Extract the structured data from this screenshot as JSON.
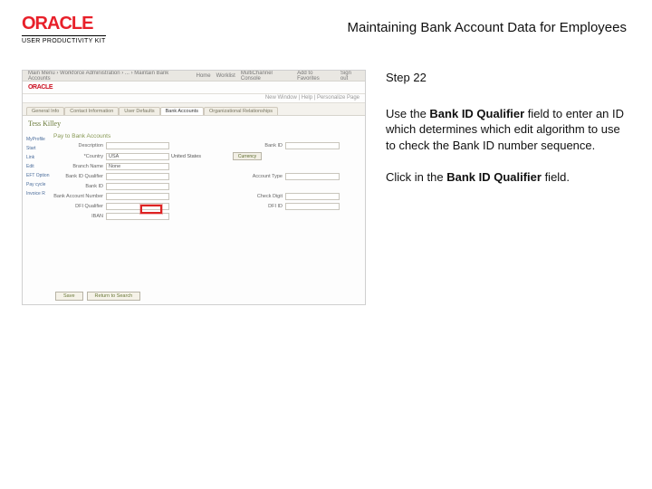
{
  "header": {
    "logo_text": "ORACLE",
    "logo_sub": "USER PRODUCTIVITY KIT",
    "title": "Maintaining Bank Account Data for Employees"
  },
  "instructions": {
    "step_label": "Step 22",
    "p1_pre": "Use the ",
    "p1_bold": "Bank ID Qualifier",
    "p1_post": " field to enter an ID which determines which edit algorithm to use to check the Bank ID number sequence.",
    "p2_pre": "Click in the ",
    "p2_bold": "Bank ID Qualifier",
    "p2_post": " field."
  },
  "thumb": {
    "top_crumbs": "Main Menu  ›  Workforce Administration  ›  ...  ›  Maintain Bank Accounts",
    "top_right1": "Home",
    "top_right2": "Worklist",
    "top_right3": "MultiChannel Console",
    "top_right4": "Add to Favorites",
    "top_right5": "Sign out",
    "brand": "ORACLE",
    "sub_right": "New Window | Help | Personalize Page",
    "tabs": [
      "General Info",
      "Contact Information",
      "User Defaults",
      "Bank Accounts",
      "Organizational Relationships"
    ],
    "heading": "Tess Killey",
    "left_links": [
      "MyProfile",
      "",
      "Start",
      "Link",
      "Edit",
      "",
      "EFT Option",
      "Pay cycle",
      "Invoice R"
    ],
    "panel_title": "Pay to Bank Accounts",
    "rows": {
      "r0_lbl": "Description",
      "r0_val": "",
      "r0b_lbl": "Bank ID",
      "r0b_val": "",
      "r1_lbl": "*Country",
      "r1_val": "USA",
      "r1_txt": "United States",
      "r1_btn": "Currency",
      "r2_lbl": "Branch Name",
      "r2_val": "None",
      "r3_lbl": "Bank ID Qualifier",
      "r3_val": "",
      "r3b_lbl": "Account Type",
      "r4_lbl": "Bank ID",
      "r4_val": "",
      "r5_lbl": "Bank Account Number",
      "r5_val": "",
      "r5b_lbl": "Check Digit",
      "r6_lbl": "DFI Qualifier",
      "r6_val": "",
      "r6b_lbl": "DFI ID",
      "r7_lbl": "IBAN",
      "r7_val": ""
    },
    "footer_save": "Save",
    "footer_return": "Return to Search"
  }
}
